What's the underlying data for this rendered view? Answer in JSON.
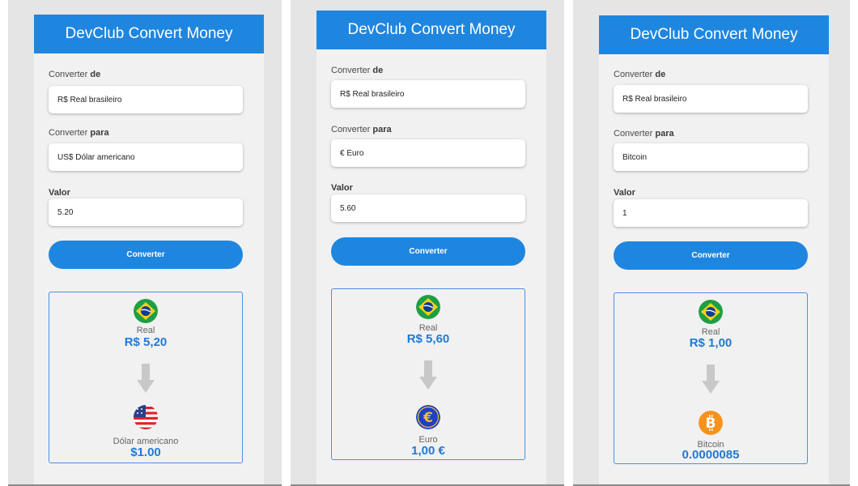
{
  "panels": [
    {
      "title": "DevClub Convert Money",
      "from_label_prefix": "Converter",
      "from_label_bold": "de",
      "from_value": "R$ Real brasileiro",
      "to_label_prefix": "Converter",
      "to_label_bold": "para",
      "to_value": "US$ Dólar americano",
      "value_label": "Valor",
      "value": "5.20",
      "button": "Converter",
      "from_name": "Real",
      "from_amount": "R$ 5,20",
      "to_name": "Dólar americano",
      "to_amount": "$1.00",
      "to_icon": "us-flag-icon"
    },
    {
      "title": "DevClub Convert Money",
      "from_label_prefix": "Converter",
      "from_label_bold": "de",
      "from_value": "R$ Real brasileiro",
      "to_label_prefix": "Converter",
      "to_label_bold": "para",
      "to_value": "€ Euro",
      "value_label": "Valor",
      "value": "5.60",
      "button": "Converter",
      "from_name": "Real",
      "from_amount": "R$ 5,60",
      "to_name": "Euro",
      "to_amount": "1,00 €",
      "to_icon": "euro-icon"
    },
    {
      "title": "DevClub Convert Money",
      "from_label_prefix": "Converter",
      "from_label_bold": "de",
      "from_value": "R$ Real brasileiro",
      "to_label_prefix": "Converter",
      "to_label_bold": "para",
      "to_value": "Bitcoin",
      "value_label": "Valor",
      "value": "1",
      "button": "Converter",
      "from_name": "Real",
      "from_amount": "R$ 1,00",
      "to_name": "Bitcoin",
      "to_amount": "0.0000085",
      "to_icon": "bitcoin-icon"
    }
  ],
  "colors": {
    "accent": "#1f86e0",
    "amount_text": "#1f7ad6",
    "result_border": "#4a90e2",
    "app_bg": "#f1f1f1",
    "page_bg": "#e5e5e5"
  }
}
